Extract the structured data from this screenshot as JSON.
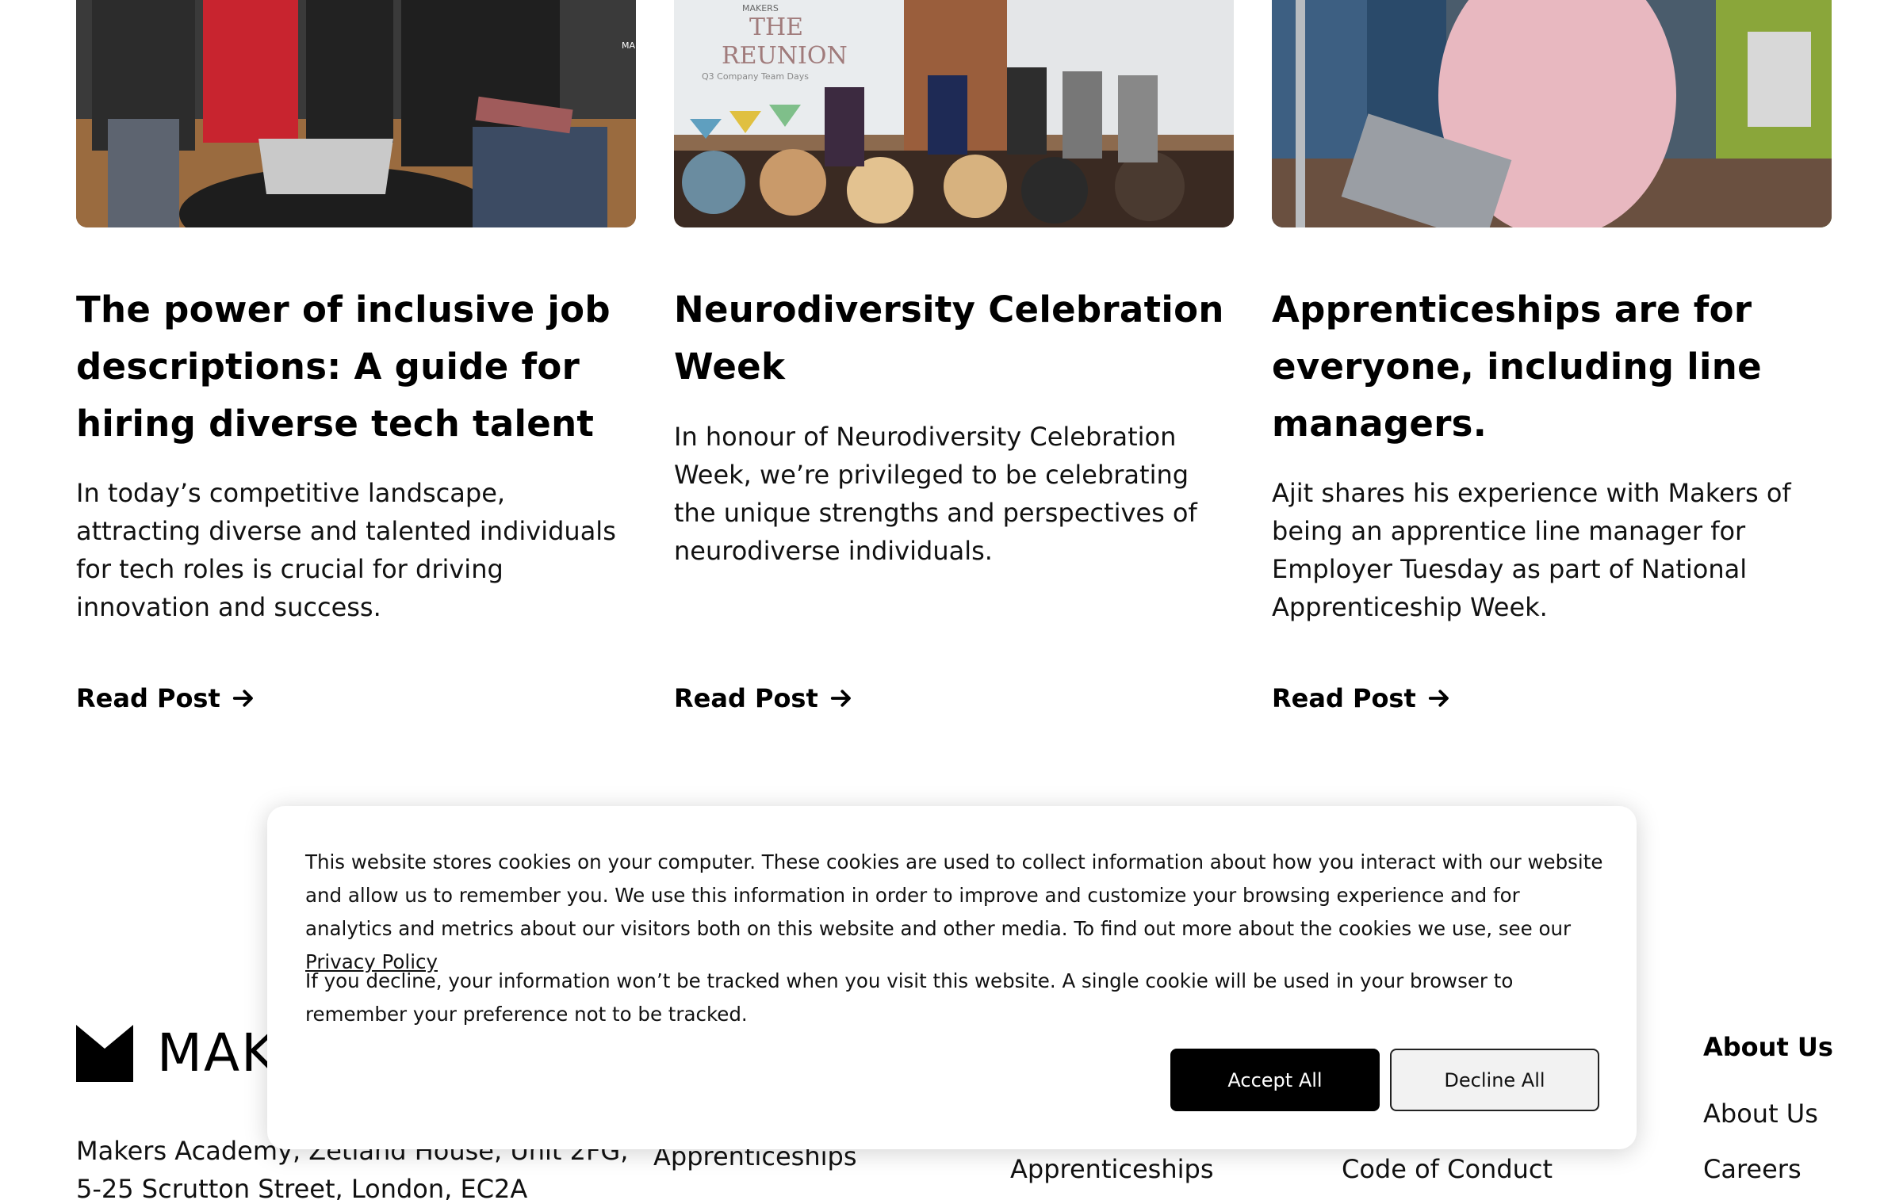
{
  "posts": [
    {
      "title": "The power of inclusive job descriptions: A guide for hiring diverse tech talent",
      "description": "In today’s competitive landscape, attracting diverse and talented individuals for tech roles is crucial for driving innovation and success.",
      "read_label": "Read Post",
      "image_logo": "MAKERS"
    },
    {
      "title": "Neurodiversity Celebration Week",
      "description": "In honour of Neurodiversity Celebration Week, we’re privileged to be celebrating the unique strengths and perspectives of neurodiverse individuals.",
      "read_label": "Read Post",
      "image_logo": "MAKERS",
      "image_screen_title_1": "THE",
      "image_screen_title_2": "REUNION",
      "image_screen_subtitle": "Q3 Company Team Days"
    },
    {
      "title": "Apprenticeships are for everyone, including line managers.",
      "description": "Ajit shares his experience with Makers of being an apprentice line manager for Employer Tuesday as part of National Apprenticeship Week.",
      "read_label": "Read Post"
    }
  ],
  "cookie_banner": {
    "text_1": "This website stores cookies on your computer. These cookies are used to collect information about how you interact with our website and allow us to remember you. We use this information in order to improve and customize your browsing experience and for analytics and metrics about our visitors both on this website and other media. To find out more about the cookies we use, see our",
    "privacy_link": "Privacy Policy",
    "text_2": "If you decline, your information won’t be tracked when you visit this website. A single cookie will be used in your browser to remember your preference not to be tracked.",
    "accept_label": "Accept All",
    "decline_label": "Decline All"
  },
  "footer": {
    "logo_text": "MAK",
    "address": "Makers Academy, Zetland House, Unit 2FG, 5-25 Scrutton Street, London, EC2A",
    "col1_item": "Apprenticeships",
    "col2_item": "Apprenticeships",
    "col3_item": "Code of Conduct",
    "col4_head": "About Us",
    "col4_items": [
      "About Us",
      "Careers"
    ]
  },
  "colors": {
    "accent": "#000000",
    "background": "#ffffff",
    "decline_bg": "#f2f2f2"
  }
}
